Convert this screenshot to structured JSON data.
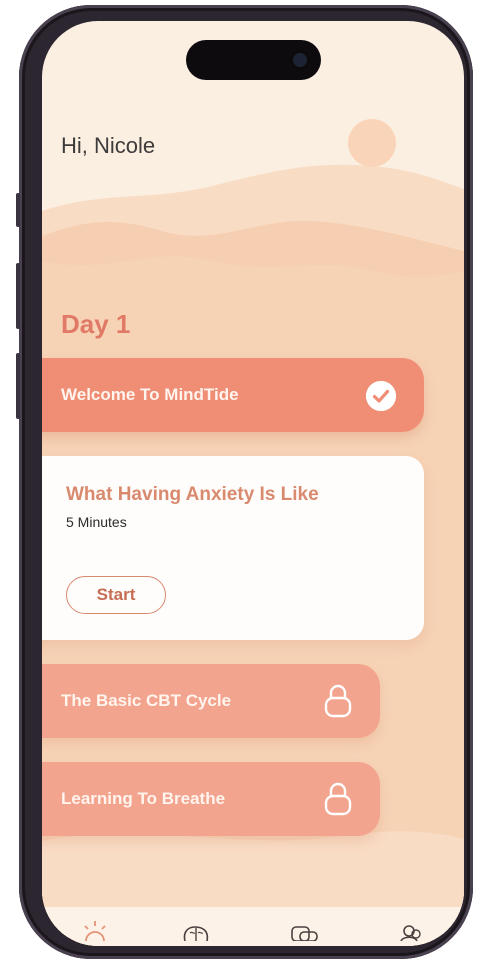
{
  "greeting": "Hi, Nicole",
  "day_title": "Day 1",
  "lessons": [
    {
      "label": "Welcome To MindTide",
      "status": "completed",
      "status_icon": "check-circle-icon"
    },
    {
      "label": "What Having Anxiety Is Like",
      "duration": "5 Minutes",
      "action": "Start",
      "status": "active"
    },
    {
      "label": "The Basic CBT Cycle",
      "status": "locked",
      "status_icon": "lock-icon"
    },
    {
      "label": "Learning To Breathe",
      "status": "locked",
      "status_icon": "lock-icon"
    }
  ],
  "tabbar": {
    "tabs": [
      {
        "icon": "sun-icon"
      },
      {
        "icon": "brain-icon"
      },
      {
        "icon": "chat-icon"
      },
      {
        "icon": "profile-icon"
      }
    ]
  },
  "colors": {
    "background": "#fbefe1",
    "accent": "#ef8d75",
    "locked_card": "#f3a48e",
    "title_text": "#e07a66",
    "card_title": "#d98a6e"
  }
}
